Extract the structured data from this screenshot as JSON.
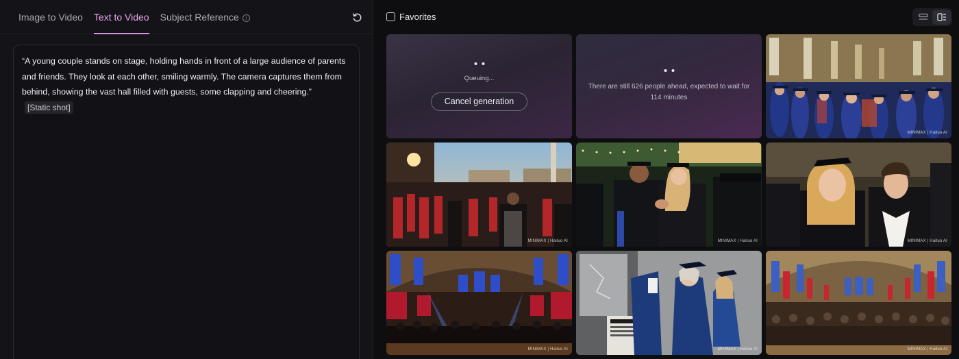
{
  "left_panel": {
    "tabs": [
      {
        "label": "Image to Video",
        "active": false
      },
      {
        "label": "Text to Video",
        "active": true
      },
      {
        "label": "Subject Reference",
        "active": false
      }
    ],
    "info_icon": "info-icon",
    "reset_icon": "refresh-icon",
    "prompt": {
      "text": "“A young couple stands on stage, holding hands in front of a large audience of parents and friends. They look at each other, smiling warmly. The camera captures them from behind, showing the vast hall filled with guests, some clapping and cheering.”",
      "tag": "[Static shot]"
    }
  },
  "right_panel": {
    "favorites_label": "Favorites",
    "view_toggle": {
      "options": [
        "list-view-icon",
        "grid-view-icon"
      ],
      "active": "grid-view-icon"
    },
    "queue_tile": {
      "status": "Queuing...",
      "cancel_label": "Cancel generation"
    },
    "wait_tile": {
      "message": "There are still 626 people ahead, expected to wait for 114 minutes"
    },
    "thumbnails": [
      {
        "name": "thumb-graduates-blue-gowns-hall"
      },
      {
        "name": "thumb-outdoor-ceremony-red-gowns"
      },
      {
        "name": "thumb-couple-holding-hands-lights"
      },
      {
        "name": "thumb-couple-smiling-closeup"
      },
      {
        "name": "thumb-cathedral-hall-blue-lights"
      },
      {
        "name": "thumb-elderly-graduate-cheering"
      },
      {
        "name": "thumb-cathedral-hall-red-banners"
      }
    ],
    "watermark": "MINIMAX | Hailuo AI"
  },
  "colors": {
    "accent": "#e9a6f0",
    "panel_bg": "#141418",
    "page_bg": "#0e0e11"
  }
}
